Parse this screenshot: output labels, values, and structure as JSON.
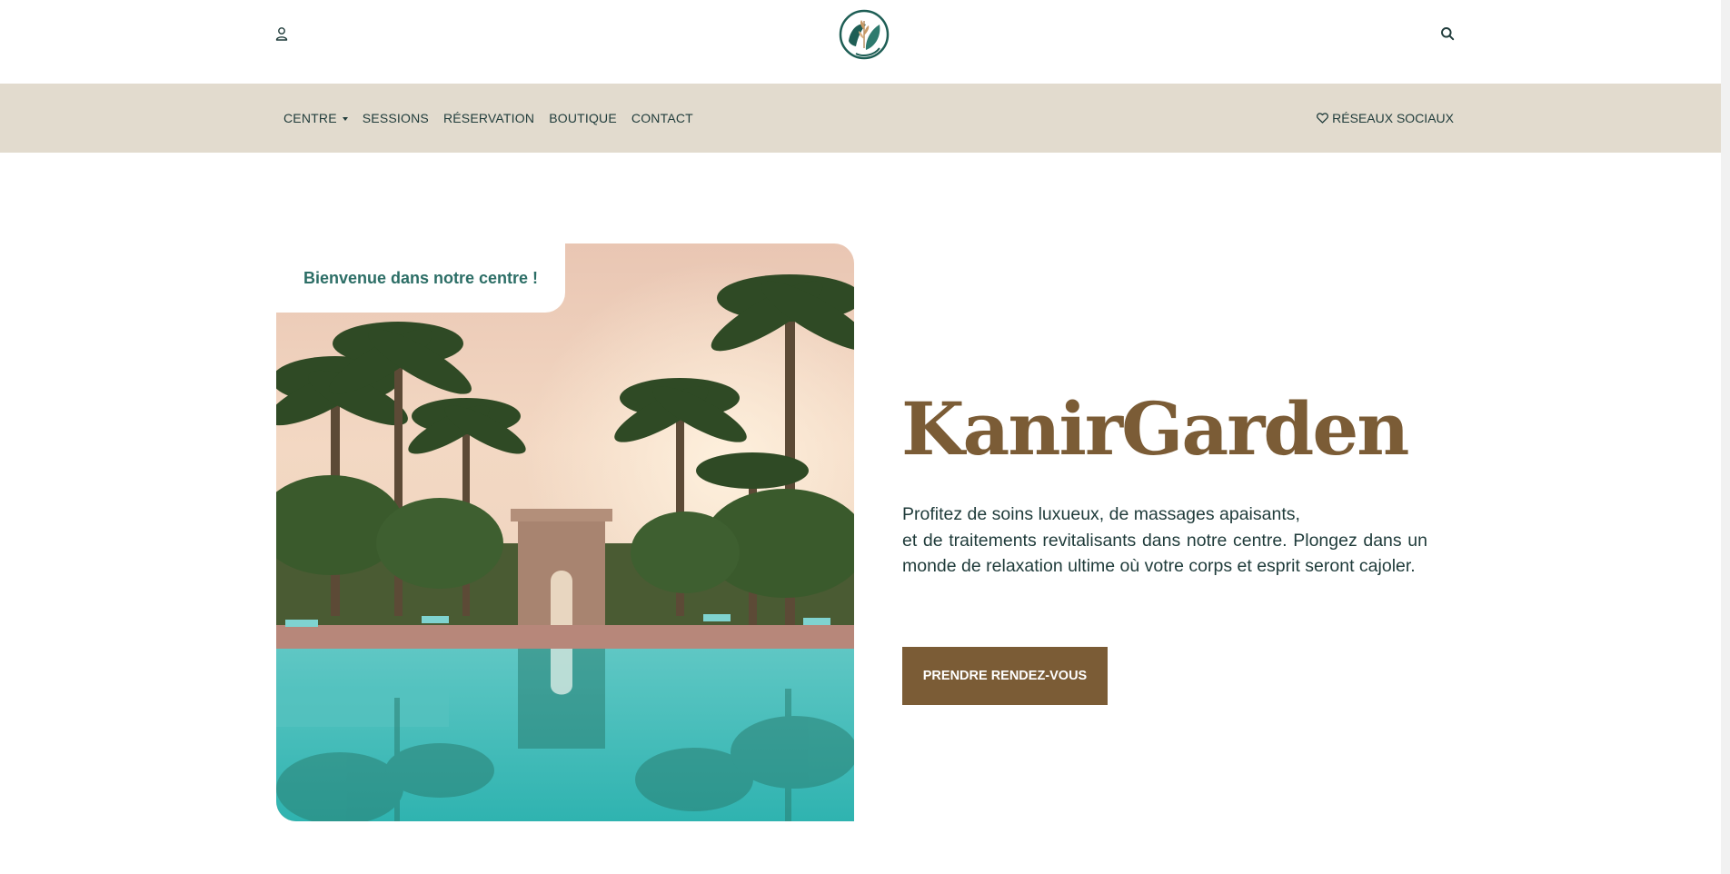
{
  "header": {
    "user_icon": "user-icon",
    "search_icon": "search-icon",
    "logo": "kanirgarden-logo"
  },
  "nav": {
    "items": [
      {
        "label": "CENTRE",
        "has_dropdown": true
      },
      {
        "label": "SESSIONS"
      },
      {
        "label": "RÉSERVATION"
      },
      {
        "label": "BOUTIQUE"
      },
      {
        "label": "CONTACT"
      }
    ],
    "social_label": "RÉSEAUX SOCIAUX",
    "social_icon": "heart-icon"
  },
  "hero": {
    "welcome": "Bienvenue dans notre centre !",
    "title": "KanirGarden",
    "description_line1": "Profitez de soins luxueux, de massages apaisants,",
    "description_rest": "et de traitements revitalisants dans notre centre. Plongez dans un monde de relaxation ultime où votre corps et esprit seront cajoler.",
    "cta_label": "PRENDRE RENDEZ-VOUS"
  },
  "colors": {
    "accent": "#7b5c36",
    "nav_bg": "#e2dbce",
    "text": "#1f3b3a",
    "welcome": "#2c6e66"
  }
}
